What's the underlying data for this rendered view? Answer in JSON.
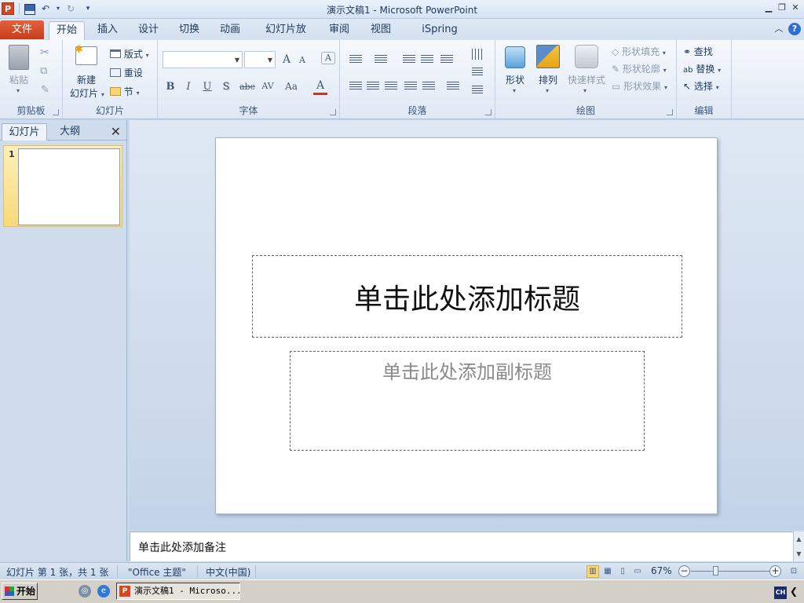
{
  "window": {
    "title": "演示文稿1 - Microsoft PowerPoint",
    "app_icon_letter": "P"
  },
  "tabs": {
    "file": "文件",
    "items": [
      "开始",
      "插入",
      "设计",
      "切换",
      "动画",
      "幻灯片放映",
      "审阅",
      "视图",
      "iSpring Free"
    ],
    "active_index": 0
  },
  "ribbon": {
    "clipboard": {
      "label": "剪贴板",
      "paste": "粘贴"
    },
    "slides": {
      "label": "幻灯片",
      "new_slide_line1": "新建",
      "new_slide_line2": "幻灯片",
      "layout": "版式",
      "reset": "重设",
      "section": "节"
    },
    "font": {
      "label": "字体",
      "font_name": "",
      "font_size": "",
      "grow": "A",
      "shrink": "A",
      "bold": "B",
      "italic": "I",
      "underline": "U",
      "shadow": "S",
      "strikethrough": "abc",
      "char_spacing": "AV",
      "change_case": "Aa",
      "font_color": "A"
    },
    "paragraph": {
      "label": "段落"
    },
    "drawing": {
      "label": "绘图",
      "shapes": "形状",
      "arrange": "排列",
      "quick_styles": "快速样式",
      "shape_fill": "形状填充",
      "shape_outline": "形状轮廓",
      "shape_effects": "形状效果"
    },
    "editing": {
      "label": "编辑",
      "find": "查找",
      "replace": "替换",
      "select": "选择"
    }
  },
  "left_panel": {
    "tabs": [
      "幻灯片",
      "大纲"
    ],
    "active_tab": 0,
    "thumbnails": [
      {
        "number": "1"
      }
    ]
  },
  "slide": {
    "title_placeholder": "单击此处添加标题",
    "subtitle_placeholder": "单击此处添加副标题"
  },
  "notes": {
    "placeholder": "单击此处添加备注"
  },
  "status_bar": {
    "slide_info": "幻灯片 第 1 张，共 1 张",
    "theme": "\"Office 主题\"",
    "language": "中文(中国)",
    "zoom": "67%"
  },
  "taskbar": {
    "start": "开始",
    "task_button": "演示文稿1 - Microso...",
    "ime": "CH"
  },
  "colors": {
    "file_tab": "#d24726",
    "ribbon_bg": "#dfe8f4",
    "selection": "#f8d97a"
  }
}
